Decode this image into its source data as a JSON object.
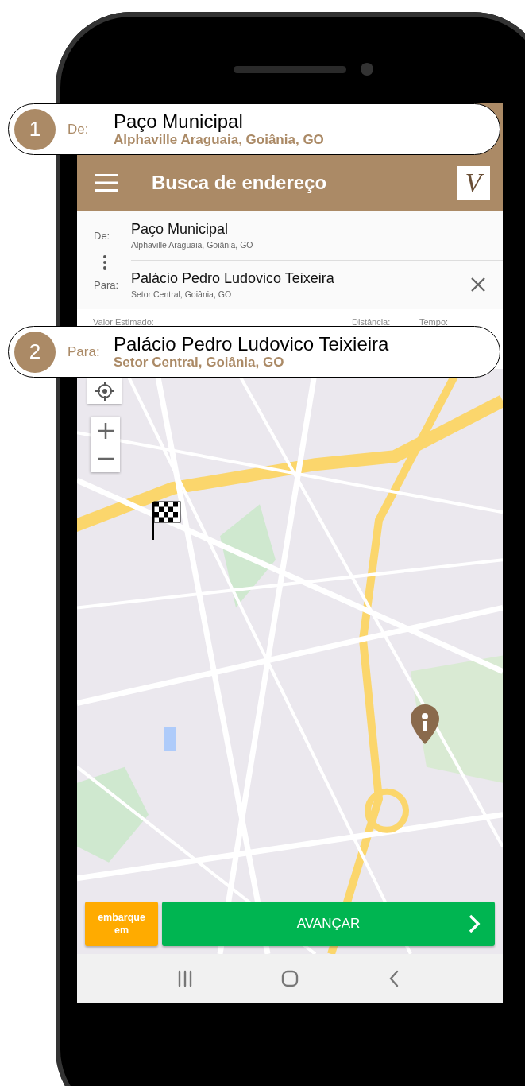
{
  "callouts": [
    {
      "number": "1",
      "label": "De:",
      "title": "Paço Municipal",
      "subtitle": "Alphaville Araguaia, Goiânia, GO"
    },
    {
      "number": "2",
      "label": "Para:",
      "title": "Palácio Pedro Ludovico Teixieira",
      "subtitle": "Setor Central, Goiânia, GO"
    }
  ],
  "app_bar": {
    "title": "Busca de endereço",
    "logo": "V"
  },
  "route": [
    {
      "label": "De:",
      "name": "Paço Municipal",
      "address": "Alphaville Araguaia, Goiânia, GO"
    },
    {
      "label": "Para:",
      "name": "Palácio Pedro Ludovico Teixeira",
      "address": "Setor Central, Goiânia, GO"
    }
  ],
  "summary": [
    "Valor Estimado:",
    "Distância:",
    "Tempo:"
  ],
  "buttons": [
    {
      "kind": "secondary",
      "label": "embarque em"
    },
    {
      "kind": "primary",
      "label": "AVANÇAR"
    }
  ]
}
